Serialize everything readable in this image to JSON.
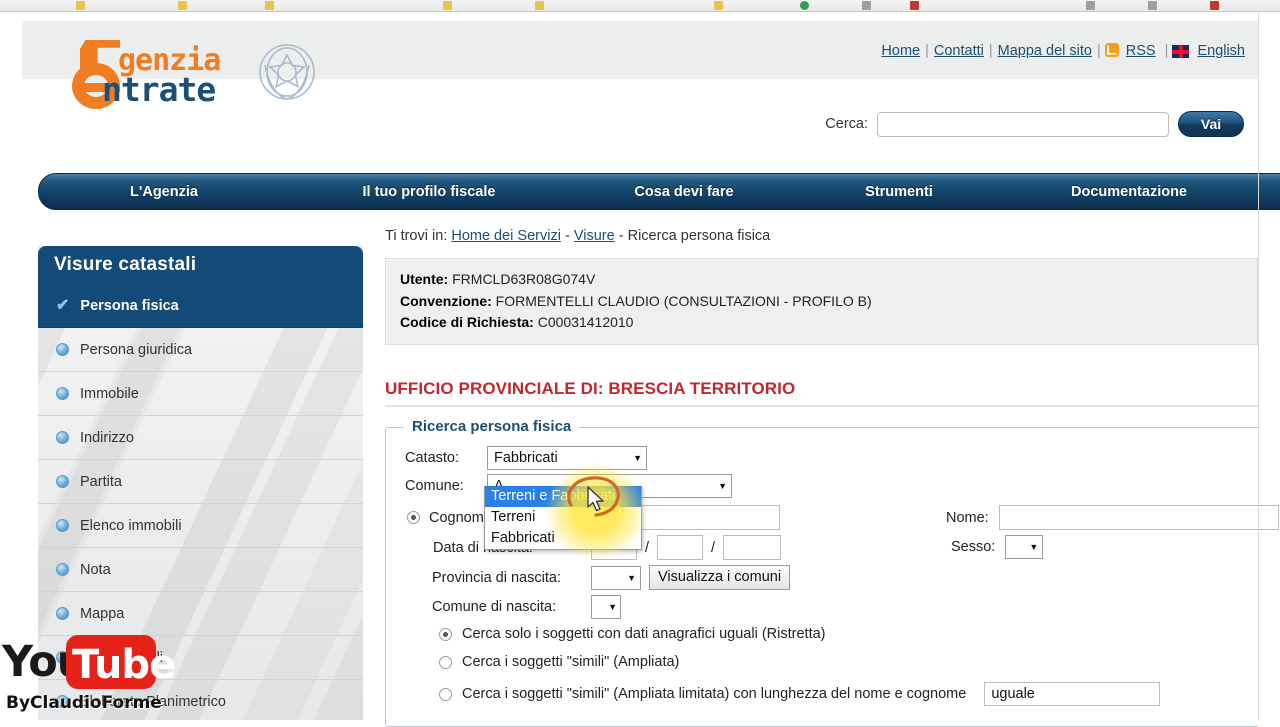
{
  "browser": {
    "bookmark_icons": [
      "folder-icon",
      "folder-icon",
      "folder-icon",
      "folder-icon",
      "folder-icon",
      "folder-icon",
      "bookmark-icon",
      "bookmark-icon",
      "bookmark-icon",
      "bookmark-icon",
      "bookmark-icon",
      "bookmark-icon"
    ]
  },
  "header": {
    "logo_word_1": "genzia",
    "logo_word_2": "ntrate",
    "emblem_name": "italian-republic-emblem",
    "toplinks": [
      {
        "label": "Home",
        "icon": ""
      },
      {
        "label": "Contatti",
        "icon": ""
      },
      {
        "label": "Mappa del sito",
        "icon": ""
      },
      {
        "label": "RSS",
        "icon": "rss-icon"
      },
      {
        "label": "English",
        "icon": "uk-flag-icon"
      }
    ],
    "search": {
      "label": "Cerca:",
      "value": "",
      "placeholder": "",
      "button_label": "Vai"
    }
  },
  "mainnav": {
    "items": [
      {
        "label": "L'Agenzia"
      },
      {
        "label": "Il tuo profilo fiscale"
      },
      {
        "label": "Cosa devi fare"
      },
      {
        "label": "Strumenti"
      },
      {
        "label": "Documentazione"
      }
    ]
  },
  "sidebar": {
    "title": "Visure catastali",
    "items": [
      {
        "label": "Persona fisica",
        "active": true
      },
      {
        "label": "Persona giuridica",
        "active": false
      },
      {
        "label": "Immobile",
        "active": false
      },
      {
        "label": "Indirizzo",
        "active": false
      },
      {
        "label": "Partita",
        "active": false
      },
      {
        "label": "Elenco immobili",
        "active": false
      },
      {
        "label": "Nota",
        "active": false
      },
      {
        "label": "Mappa",
        "active": false
      },
      {
        "label": "Dati catastali",
        "active": false
      },
      {
        "label": "Elaborato Planimetrico",
        "active": false
      }
    ]
  },
  "breadcrumb": {
    "prefix": "Ti trovi in:",
    "link1": "Home dei Servizi",
    "sep1": "-",
    "link2": "Visure",
    "sep2": "-",
    "current": "Ricerca persona fisica"
  },
  "userbox": {
    "utente_label": "Utente:",
    "utente_value": "FRMCLD63R08G074V",
    "convenzione_label": "Convenzione:",
    "convenzione_value": "FORMENTELLI CLAUDIO (CONSULTAZIONI - PROFILO B)",
    "codice_label": "Codice di Richiesta:",
    "codice_value": "C00031412010"
  },
  "office_title": "UFFICIO PROVINCIALE DI: BRESCIA TERRITORIO",
  "form": {
    "legend": "Ricerca persona fisica",
    "catasto": {
      "label": "Catasto:",
      "value": "Fabbricati",
      "open": true,
      "options": [
        {
          "label": "Terreni e Fabbricati",
          "highlighted": true
        },
        {
          "label": "Terreni",
          "highlighted": false
        },
        {
          "label": "Fabbricati",
          "highlighted": false
        }
      ]
    },
    "comune": {
      "label": "Comune:",
      "value": "A"
    },
    "cognome": {
      "label": "Cognome:",
      "value": "",
      "radio_selected": true
    },
    "nome": {
      "label": "Nome:",
      "value": ""
    },
    "data_nascita": {
      "label": "Data di nascita:",
      "day": "",
      "month": "",
      "year": "",
      "separator": "/"
    },
    "sesso": {
      "label": "Sesso:",
      "value": ""
    },
    "provincia_nascita": {
      "label": "Provincia di nascita:",
      "value": "",
      "button_label": "Visualizza i comuni"
    },
    "comune_nascita": {
      "label": "Comune di nascita:",
      "value": ""
    },
    "search_modes": [
      {
        "label": "Cerca solo i soggetti con dati anagrafici uguali (Ristretta)",
        "selected": true
      },
      {
        "label": "Cerca i soggetti \"simili\" (Ampliata)",
        "selected": false
      },
      {
        "label": "Cerca i soggetti \"simili\" (Ampliata limitata) con lunghezza del nome e cognome",
        "selected": false
      }
    ],
    "lunghezza_value": "uguale"
  },
  "annotation": {
    "cursor_name": "mouse-pointer",
    "highlight_color": "#ffe63c",
    "circle_color": "#d2691e"
  },
  "watermark": {
    "you": "You",
    "tube": "Tube",
    "byline": "ByClaudioForme"
  },
  "colors": {
    "brand_navy": "#134a77",
    "brand_orange": "#f07d22",
    "office_red": "#c0282d",
    "select_highlight": "#2a7fe8"
  }
}
